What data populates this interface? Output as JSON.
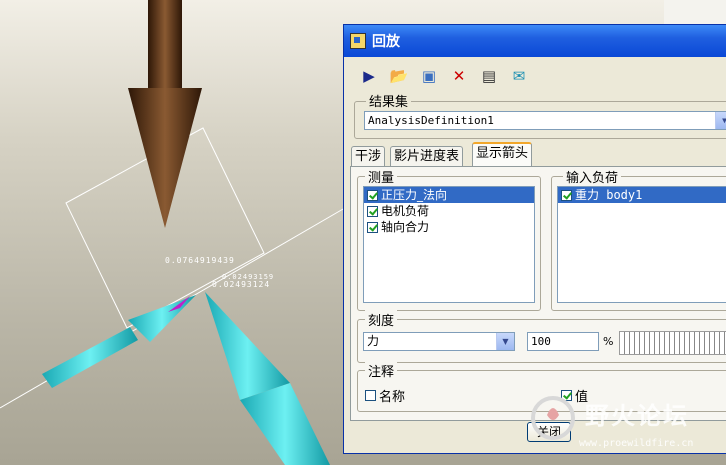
{
  "viewport": {
    "measure_labels": [
      "0.0764919439",
      "0.02493159",
      "0.02493124"
    ]
  },
  "dialog": {
    "title": "回放",
    "toolbar": [
      "play-icon",
      "open-folder-icon",
      "save-icon",
      "delete-icon",
      "export-icon",
      "capture-icon"
    ],
    "result_set": {
      "label": "结果集",
      "value": "AnalysisDefinition1"
    },
    "tabs": [
      "干涉",
      "影片进度表",
      "显示箭头"
    ],
    "active_tab": "显示箭头",
    "measure": {
      "label": "测量",
      "items": [
        {
          "label": "正压力_法向",
          "checked": true,
          "selected": true
        },
        {
          "label": "电机负荷",
          "checked": true,
          "selected": false
        },
        {
          "label": "轴向合力",
          "checked": true,
          "selected": false
        }
      ]
    },
    "input_load": {
      "label": "输入负荷",
      "items": [
        {
          "label": "重力 body1",
          "checked": true,
          "selected": true
        }
      ]
    },
    "scale": {
      "label": "刻度",
      "type_value": "力",
      "percent_value": "100",
      "percent_unit": "%"
    },
    "annotation": {
      "label": "注释",
      "name_label": "名称",
      "name_checked": false,
      "value_label": "值",
      "value_checked": true
    },
    "close_label": "关闭"
  },
  "watermark": {
    "text": "野火论坛",
    "url": "www.proewildfire.cn"
  },
  "colors": {
    "accent": "#316ac5",
    "title_bar": "#0a48d6",
    "arrow_brown": "#5a3418",
    "arrow_cyan": "#2fd3d8"
  }
}
